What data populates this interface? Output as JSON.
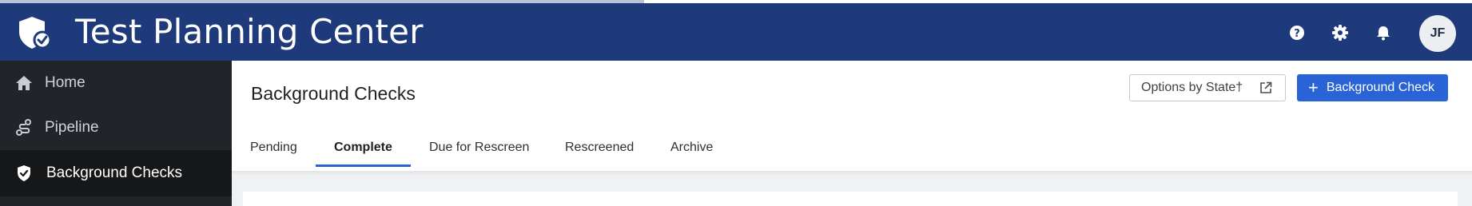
{
  "header": {
    "app_title": "Test Planning Center",
    "icons": [
      "help-icon",
      "gear-icon",
      "bell-icon"
    ],
    "avatar_initials": "JF"
  },
  "sidebar": {
    "items": [
      {
        "label": "Home",
        "icon": "home-icon"
      },
      {
        "label": "Pipeline",
        "icon": "pipeline-icon"
      },
      {
        "label": "Background Checks",
        "icon": "shield-check-icon",
        "active": true
      }
    ]
  },
  "main": {
    "page_title": "Background Checks",
    "options_button_label": "Options by State†",
    "add_button_label": "Background Check",
    "tabs": [
      {
        "label": "Pending"
      },
      {
        "label": "Complete",
        "active": true
      },
      {
        "label": "Due for Rescreen"
      },
      {
        "label": "Rescreened"
      },
      {
        "label": "Archive"
      }
    ]
  },
  "colors": {
    "header_bg": "#1f3a7b",
    "sidebar_bg": "#212529",
    "primary": "#2a63d6"
  }
}
